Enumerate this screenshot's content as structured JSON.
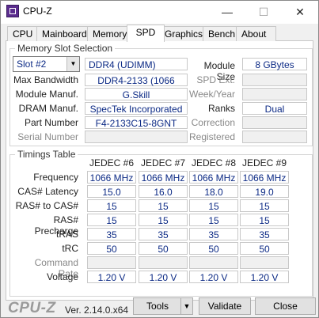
{
  "window": {
    "title": "CPU-Z",
    "minimize_label": "—",
    "maximize_label": "☐",
    "close_label": "✕"
  },
  "tabs": [
    {
      "label": "CPU",
      "active": false
    },
    {
      "label": "Mainboard",
      "active": false
    },
    {
      "label": "Memory",
      "active": false
    },
    {
      "label": "SPD",
      "active": true
    },
    {
      "label": "Graphics",
      "active": false
    },
    {
      "label": "Bench",
      "active": false
    },
    {
      "label": "About",
      "active": false
    }
  ],
  "slot_section": {
    "legend": "Memory Slot Selection",
    "slot_select_value": "Slot #2",
    "memory_type": "DDR4 (UDIMM)",
    "labels": {
      "max_bandwidth": "Max Bandwidth",
      "module_manuf": "Module Manuf.",
      "dram_manuf": "DRAM Manuf.",
      "part_number": "Part Number",
      "serial_number": "Serial Number",
      "module_size": "Module Size",
      "spd_ext": "SPD Ext.",
      "week_year": "Week/Year",
      "ranks": "Ranks",
      "correction": "Correction",
      "registered": "Registered"
    },
    "values": {
      "max_bandwidth": "DDR4-2133 (1066 MHz)",
      "module_manuf": "G.Skill",
      "dram_manuf": "SpecTek Incorporated",
      "part_number": "F4-2133C15-8GNT",
      "serial_number": "",
      "module_size": "8 GBytes",
      "spd_ext": "",
      "week_year": "",
      "ranks": "Dual",
      "correction": "",
      "registered": ""
    }
  },
  "timings": {
    "legend": "Timings Table",
    "columns": [
      "JEDEC #6",
      "JEDEC #7",
      "JEDEC #8",
      "JEDEC #9"
    ],
    "rows": [
      {
        "label": "Frequency",
        "values": [
          "1066 MHz",
          "1066 MHz",
          "1066 MHz",
          "1066 MHz"
        ]
      },
      {
        "label": "CAS# Latency",
        "values": [
          "15.0",
          "16.0",
          "18.0",
          "19.0"
        ]
      },
      {
        "label": "RAS# to CAS#",
        "values": [
          "15",
          "15",
          "15",
          "15"
        ]
      },
      {
        "label": "RAS# Precharge",
        "values": [
          "15",
          "15",
          "15",
          "15"
        ]
      },
      {
        "label": "tRAS",
        "values": [
          "35",
          "35",
          "35",
          "35"
        ]
      },
      {
        "label": "tRC",
        "values": [
          "50",
          "50",
          "50",
          "50"
        ]
      },
      {
        "label": "Command Rate",
        "values": [
          "",
          "",
          "",
          ""
        ]
      },
      {
        "label": "Voltage",
        "values": [
          "1.20 V",
          "1.20 V",
          "1.20 V",
          "1.20 V"
        ]
      }
    ]
  },
  "footer": {
    "logo": "CPU-Z",
    "version": "Ver. 2.14.0.x64",
    "tools_label": "Tools",
    "validate_label": "Validate",
    "close_label": "Close"
  }
}
